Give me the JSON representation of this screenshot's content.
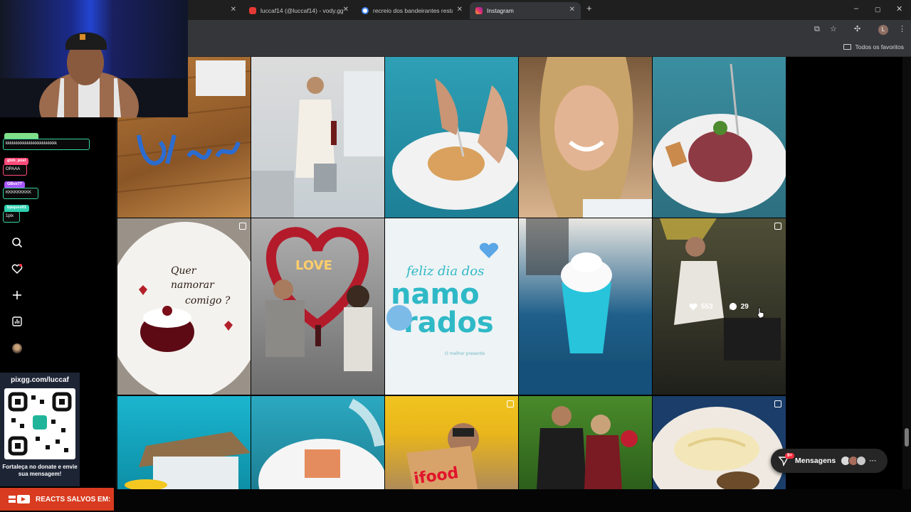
{
  "browser": {
    "tabs": [
      {
        "label": "luccaf14 (@luccaf14) - vody.gg",
        "favicon": "vody-icon",
        "color": "#e53935",
        "active": false
      },
      {
        "label": "recreio dos bandeirantes restau",
        "favicon": "google-icon",
        "color": "#4285f4",
        "active": false
      },
      {
        "label": "Instagram",
        "favicon": "instagram-icon",
        "color": "#e1306c",
        "active": true
      }
    ],
    "new_tab": "+",
    "window_controls": [
      "–",
      "▢",
      "✕"
    ],
    "bookmarks_folder": "Todos os favoritos",
    "profile_initial": "L"
  },
  "chat": {
    "messages": [
      {
        "user": "",
        "text": "kkkkkkkkkkkkkkkkkkkkkkkk",
        "badge_color": "#7fe08a"
      },
      {
        "user": "glob_post",
        "text": "OPAAA",
        "badge_color": "#ff4b7a"
      },
      {
        "user": "GBox77",
        "text": "KKKKKKKKK",
        "badge_color": "#a656ff"
      },
      {
        "user": "bjaques01",
        "text": "1pix",
        "badge_color": "#2fd0b0"
      }
    ]
  },
  "sidebar": {
    "icons": [
      "search-icon",
      "notifications-icon",
      "create-icon",
      "dashboard-icon",
      "profile-avatar"
    ]
  },
  "post_stats": {
    "likes": "553",
    "comments": "29"
  },
  "pix": {
    "url": "pixgg.com/luccaf",
    "message": "Fortaleça no donate e envie sua mensagem!"
  },
  "reacts": {
    "label": "REACTS SALVOS EM:"
  },
  "messages": {
    "label": "Mensagens",
    "badge": "9+"
  },
  "posts": [
    {
      "row": 0,
      "col": 0,
      "subject": "Blue restaurant sign",
      "carousel": false
    },
    {
      "row": 0,
      "col": 1,
      "subject": "Woman holding wine bottle",
      "carousel": false
    },
    {
      "row": 0,
      "col": 2,
      "subject": "Fish dish being cut",
      "carousel": false
    },
    {
      "row": 0,
      "col": 3,
      "subject": "Smiling woman portrait",
      "carousel": false
    },
    {
      "row": 0,
      "col": 4,
      "subject": "Steak tartare plate",
      "carousel": false
    },
    {
      "row": 1,
      "col": 0,
      "subject": "Quer namorar comigo dessert",
      "carousel": true,
      "text": "Quer namorar comigo ?"
    },
    {
      "row": 1,
      "col": 1,
      "subject": "Couple under LOVE heart",
      "carousel": false,
      "text": "LOVE"
    },
    {
      "row": 1,
      "col": 2,
      "subject": "Feliz dia dos namorados",
      "carousel": false,
      "text": "feliz dia dos namorados"
    },
    {
      "row": 1,
      "col": 3,
      "subject": "Blue drink with cream",
      "carousel": false
    },
    {
      "row": 1,
      "col": 4,
      "subject": "Woman seated in restaurant",
      "carousel": true
    },
    {
      "row": 2,
      "col": 0,
      "subject": "Restaurant exterior",
      "carousel": false
    },
    {
      "row": 2,
      "col": 1,
      "subject": "Salmon dish",
      "carousel": false
    },
    {
      "row": 2,
      "col": 2,
      "subject": "Woman holding ifood box",
      "carousel": true,
      "text": "ifood"
    },
    {
      "row": 2,
      "col": 3,
      "subject": "Couple with flowers",
      "carousel": false
    },
    {
      "row": 2,
      "col": 4,
      "subject": "Mashed potato plate",
      "carousel": true
    }
  ]
}
